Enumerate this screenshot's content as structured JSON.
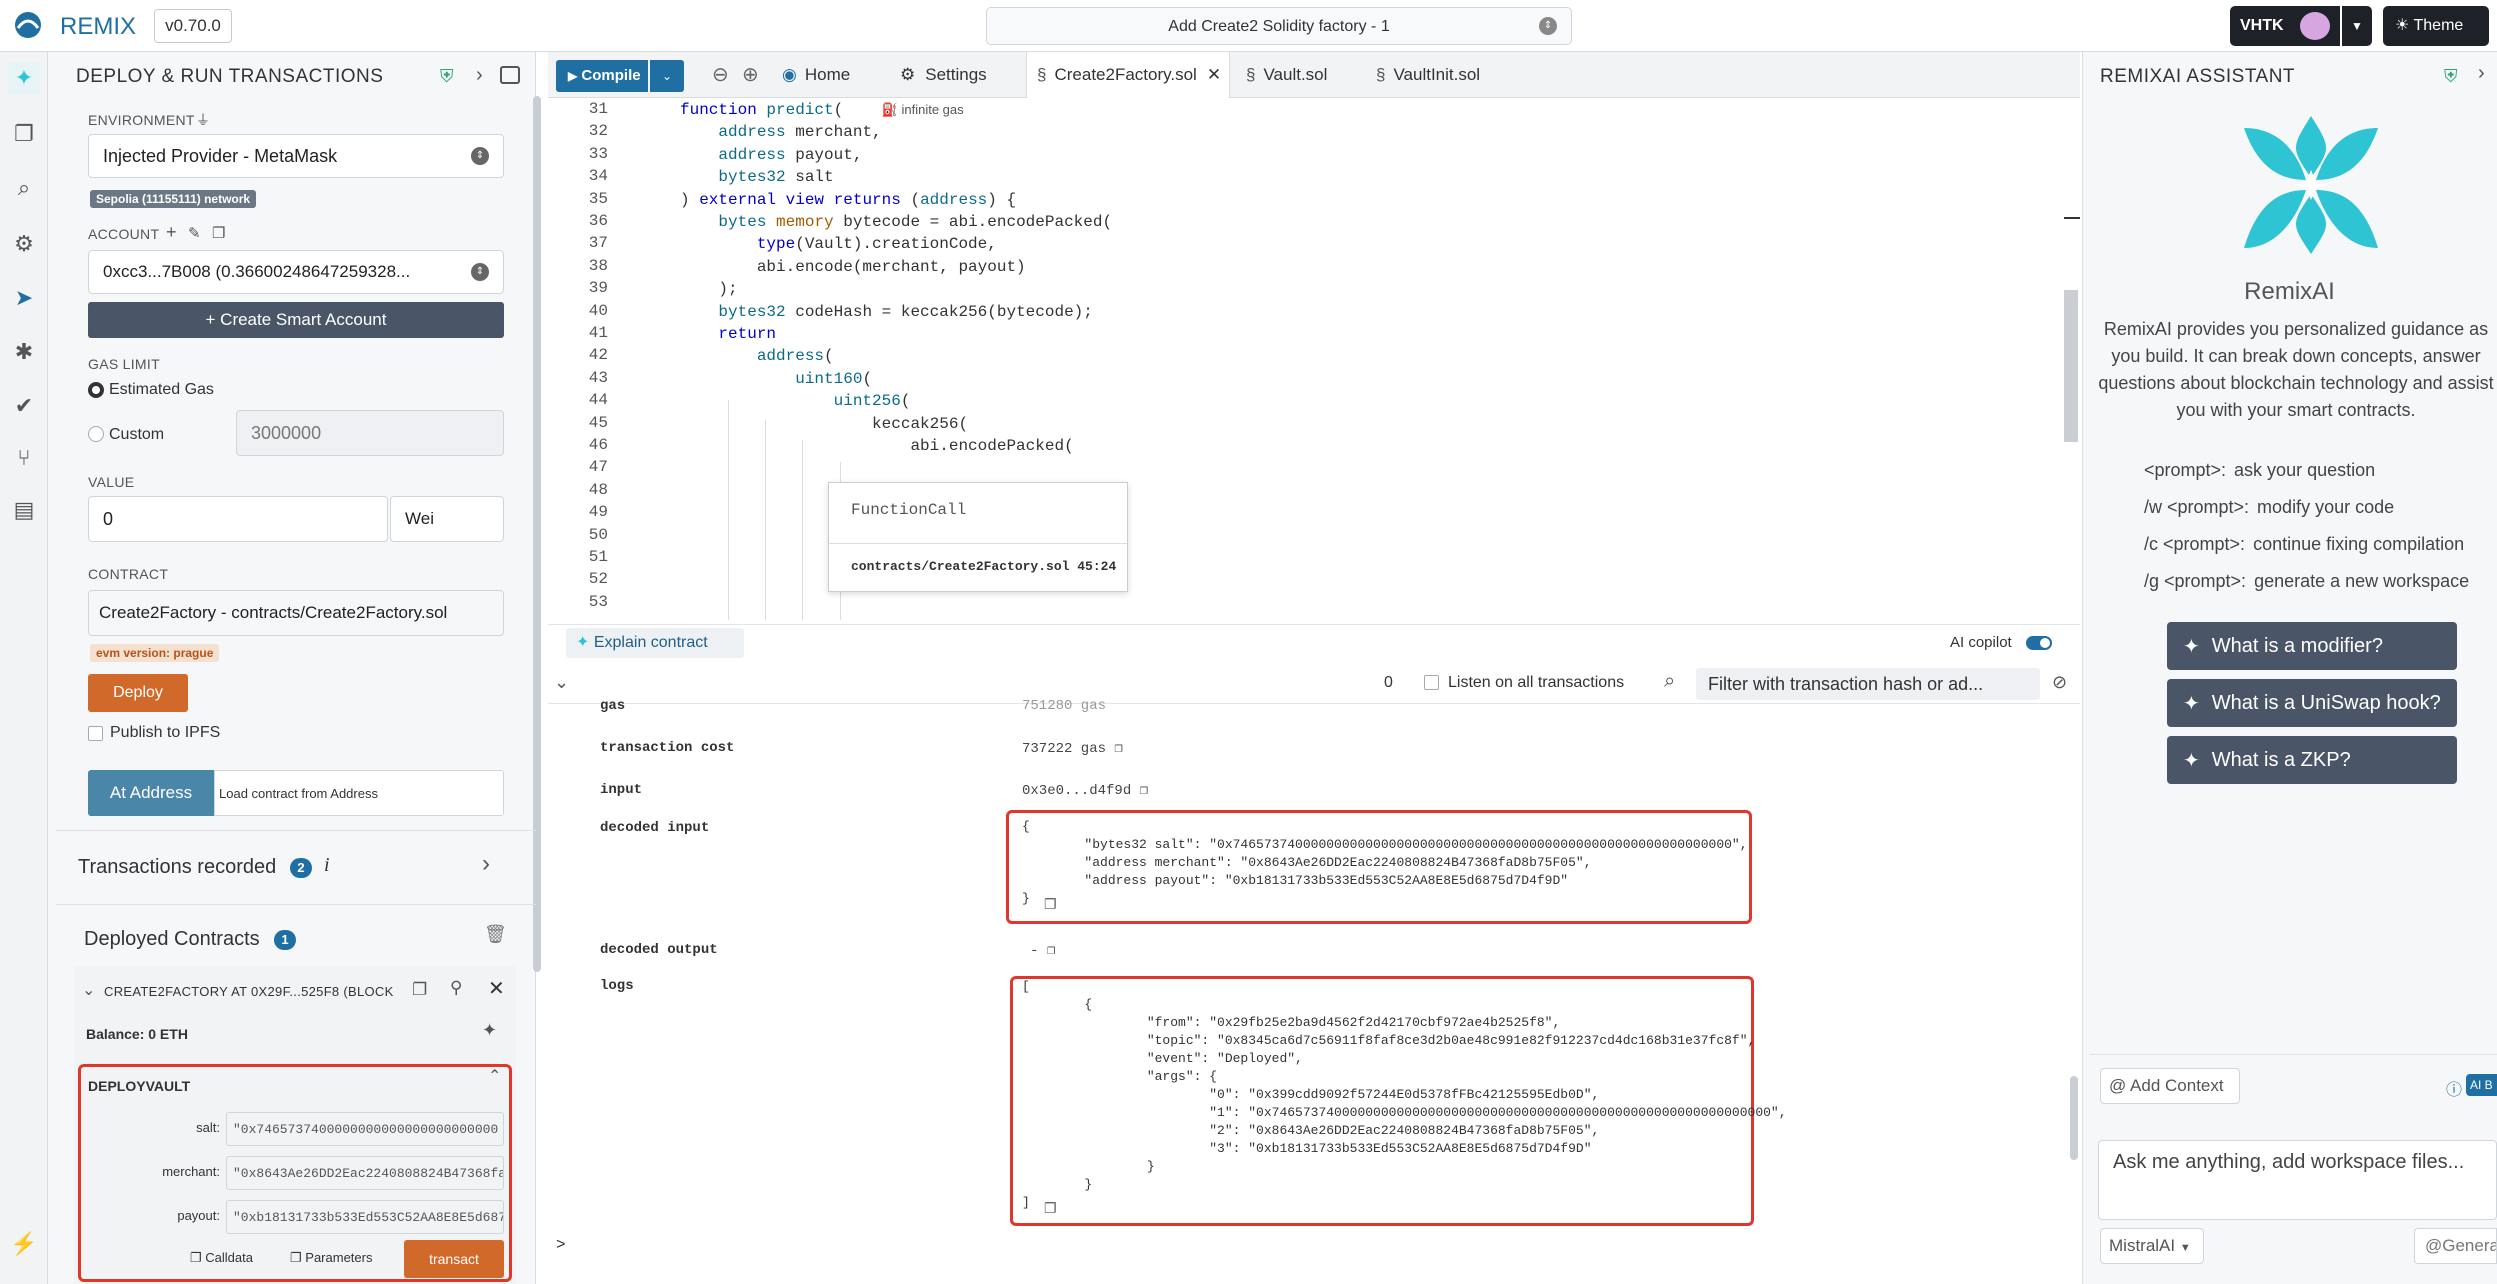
{
  "topbar": {
    "brand": "REMIX",
    "version": "v0.70.0",
    "workspace": "Add Create2 Solidity factory - 1",
    "account_badge": "VHTK",
    "theme_label": "Theme"
  },
  "left": {
    "title": "DEPLOY & RUN TRANSACTIONS",
    "environment_label": "ENVIRONMENT",
    "environment_value": "Injected Provider - MetaMask",
    "network_badge": "Sepolia (11155111) network",
    "account_label": "ACCOUNT",
    "account_value": "0xcc3...7B008 (0.36600248647259328...",
    "create_smart_account": "+ Create Smart Account",
    "gas_limit_label": "GAS LIMIT",
    "estimated_gas": "Estimated Gas",
    "custom": "Custom",
    "custom_gas_value": "3000000",
    "value_label": "VALUE",
    "value_amount": "0",
    "value_unit": "Wei",
    "contract_label": "CONTRACT",
    "contract_value": "Create2Factory - contracts/Create2Factory.sol",
    "evm_badge": "evm version: prague",
    "deploy_button": "Deploy",
    "publish_ipfs": "Publish to IPFS",
    "at_address_button": "At Address",
    "at_address_placeholder": "Load contract from Address",
    "transactions_recorded": "Transactions recorded",
    "transactions_count": "2",
    "deployed_contracts": "Deployed Contracts",
    "deployed_count": "1",
    "instance_title": "CREATE2FACTORY AT 0X29F...525F8 (BLOCK",
    "balance": "Balance: 0 ETH",
    "function_name": "DEPLOYVAULT",
    "params": [
      {
        "label": "salt:",
        "value": "\"0x7465737400000000000000000000000"
      },
      {
        "label": "merchant:",
        "value": "\"0x8643Ae26DD2Eac2240808824B47368fa"
      },
      {
        "label": "payout:",
        "value": "\"0xb18131733b533Ed553C52AA8E8E5d687"
      }
    ],
    "calldata_btn": "Calldata",
    "parameters_btn": "Parameters",
    "transact_btn": "transact"
  },
  "editor": {
    "compile_button": "Compile",
    "tabs": [
      "Home",
      "Settings",
      "Create2Factory.sol",
      "Vault.sol",
      "VaultInit.sol"
    ],
    "gas_hint": "infinite gas",
    "tooltip_title": "FunctionCall",
    "tooltip_ref": "contracts/Create2Factory.sol 45:24",
    "line_numbers": [
      "31",
      "32",
      "33",
      "34",
      "35",
      "36",
      "37",
      "38",
      "39",
      "40",
      "41",
      "42",
      "43",
      "44",
      "45",
      "46",
      "47",
      "48",
      "49",
      "50",
      "51",
      "52",
      "53"
    ],
    "explain_contract": "Explain contract",
    "ai_copilot": "AI copilot"
  },
  "terminal": {
    "count": "0",
    "listen_label": "Listen on all transactions",
    "filter_placeholder": "Filter with transaction hash or ad...",
    "gas_label": "gas",
    "gas_value": "751280 gas",
    "tx_cost_label": "transaction cost",
    "tx_cost_value": "737222 gas",
    "input_label": "input",
    "input_value": "0x3e0...d4f9d",
    "decoded_input_label": "decoded input",
    "decoded_output_label": "decoded output",
    "decoded_output_value": "-",
    "logs_label": "logs",
    "prompt": ">"
  },
  "right": {
    "title": "REMIXAI ASSISTANT",
    "name": "RemixAI",
    "description": "RemixAI provides you personalized guidance as you build. It can break down concepts, answer questions about blockchain technology and assist you with your smart contracts.",
    "commands": [
      {
        "cmd": "<prompt>:",
        "desc": "ask your question"
      },
      {
        "cmd": "/w <prompt>:",
        "desc": "modify your code"
      },
      {
        "cmd": "/c <prompt>:",
        "desc": "continue fixing compilation"
      },
      {
        "cmd": "/g <prompt>:",
        "desc": "generate a new workspace"
      }
    ],
    "suggestions": [
      "What is a modifier?",
      "What is a UniSwap hook?",
      "What is a ZKP?"
    ],
    "add_context": "@ Add Context",
    "ask_placeholder": "Ask me anything, add workspace files...",
    "model": "MistralAI",
    "generate": "@Genera"
  },
  "colors": {
    "accent": "#1f6fa3",
    "deploy": "#d0692a",
    "remix_logo": "#2ec4d3",
    "highlight_red": "#e0362b"
  }
}
